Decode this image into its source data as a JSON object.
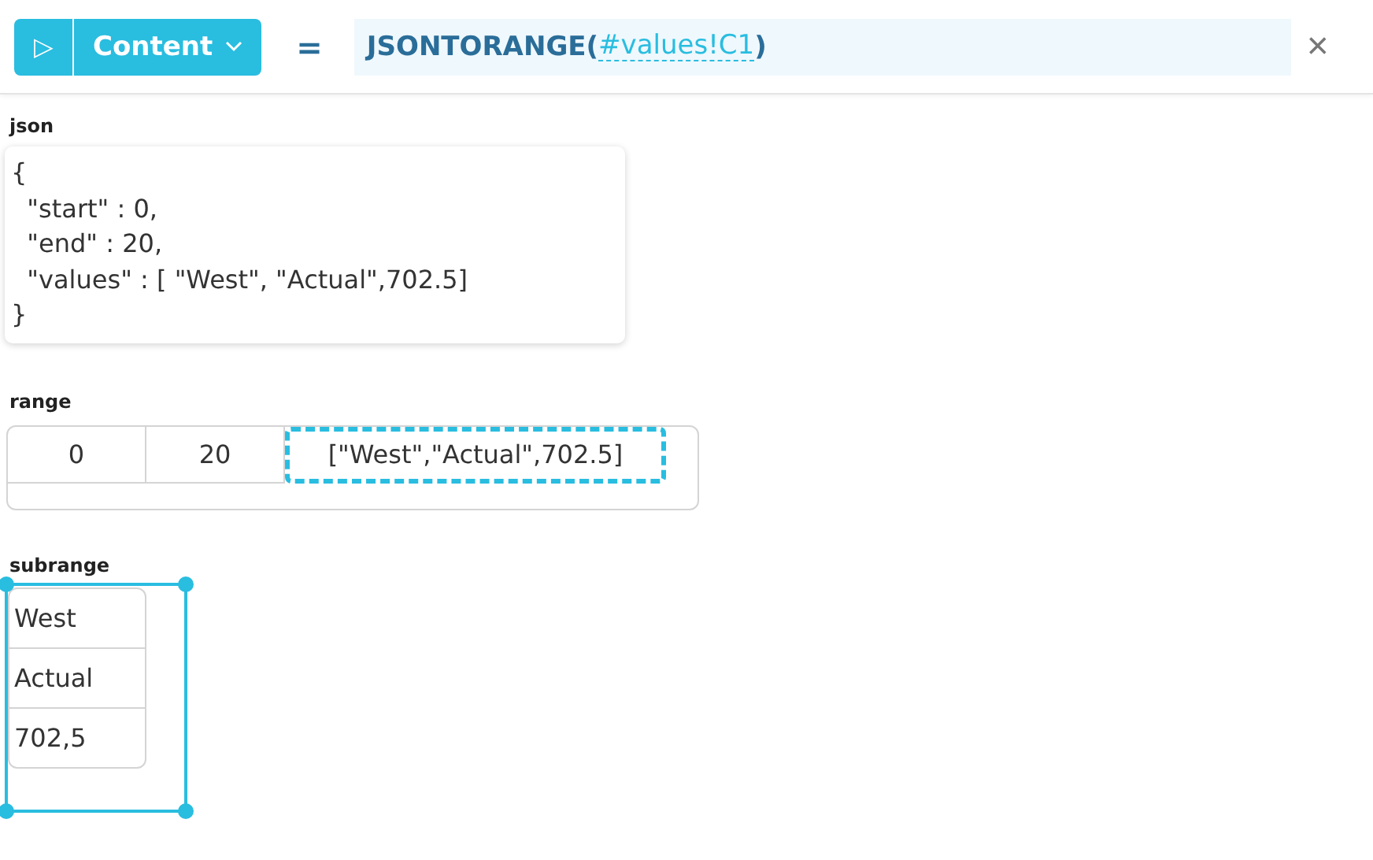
{
  "toolbar": {
    "run_icon": "▷",
    "mode": "Content",
    "equals": "=",
    "formula": {
      "function": "JSONTORANGE(",
      "reference": "#values!C1",
      "close": ")"
    },
    "close": "×"
  },
  "json": {
    "label": "json",
    "lines": [
      "{",
      "  \"start\" : 0,",
      "  \"end\" : 20,",
      "  \"values\" : [ \"West\", \"Actual\",702.5]",
      "}"
    ]
  },
  "range": {
    "label": "range",
    "cells": [
      {
        "text": "0",
        "selected": false
      },
      {
        "text": "20",
        "selected": false
      },
      {
        "text": "[\"West\",\"Actual\",702.5]",
        "selected": true
      }
    ]
  },
  "subrange": {
    "label": "subrange",
    "selected": true,
    "cells": [
      "West",
      "Actual",
      "702,5"
    ]
  }
}
